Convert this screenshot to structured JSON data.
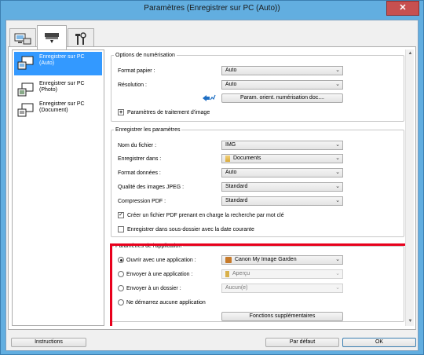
{
  "window": {
    "title": "Paramètres (Enregistrer sur PC (Auto))",
    "close_glyph": "✕"
  },
  "tabs": [
    {
      "name": "scan-from-computer",
      "icon": "computer-scan-icon"
    },
    {
      "name": "scan-from-operation-panel",
      "icon": "scanner-panel-icon"
    },
    {
      "name": "general-settings",
      "icon": "tools-icon"
    }
  ],
  "sidebar": {
    "items": [
      {
        "label_1": "Enregistrer sur PC",
        "label_2": "(Auto)",
        "icon": "scan-auto-icon",
        "selected": true
      },
      {
        "label_1": "Enregistrer sur PC",
        "label_2": "(Photo)",
        "icon": "scan-photo-icon",
        "selected": false
      },
      {
        "label_1": "Enregistrer sur PC",
        "label_2": "(Document)",
        "icon": "scan-document-icon",
        "selected": false
      }
    ]
  },
  "scan_options": {
    "legend": "Options de numérisation",
    "paper_size_label": "Format papier :",
    "paper_size_value": "Auto",
    "resolution_label": "Résolution :",
    "resolution_value": "Auto",
    "orientation_button": "Param. orient. numérisation doc....",
    "image_processing_label": "Paramètres de traitement d'image",
    "expand_glyph": "+"
  },
  "save_settings": {
    "legend": "Enregistrer les paramètres",
    "file_name_label": "Nom du fichier :",
    "file_name_value": "IMG",
    "save_in_label": "Enregistrer dans :",
    "save_in_value": "Documents",
    "data_format_label": "Format données :",
    "data_format_value": "Auto",
    "jpeg_quality_label": "Qualité des images JPEG :",
    "jpeg_quality_value": "Standard",
    "pdf_compression_label": "Compression PDF :",
    "pdf_compression_value": "Standard",
    "searchable_pdf_label": "Créer un fichier PDF prenant en charge la recherche par mot clé",
    "searchable_pdf_checked": true,
    "subfolder_label": "Enregistrer dans sous-dossier avec la date courante",
    "subfolder_checked": false
  },
  "app_settings": {
    "legend": "Paramètres de l'application",
    "open_with_label": "Ouvrir avec une application :",
    "open_with_value": "Canon My Image Garden",
    "send_to_app_label": "Envoyer à une application :",
    "send_to_app_value": "Aperçu",
    "send_to_folder_label": "Envoyer à un dossier :",
    "send_to_folder_value": "Aucun(e)",
    "no_app_label": "Ne démarrez aucune application",
    "selected_option": "open_with",
    "more_functions_button": "Fonctions supplémentaires"
  },
  "footer": {
    "instructions_button": "Instructions",
    "defaults_button": "Par défaut",
    "ok_button": "OK"
  },
  "colors": {
    "highlight": "#3399ff",
    "red_frame": "#e8001c",
    "title_bar": "#62aee0"
  }
}
